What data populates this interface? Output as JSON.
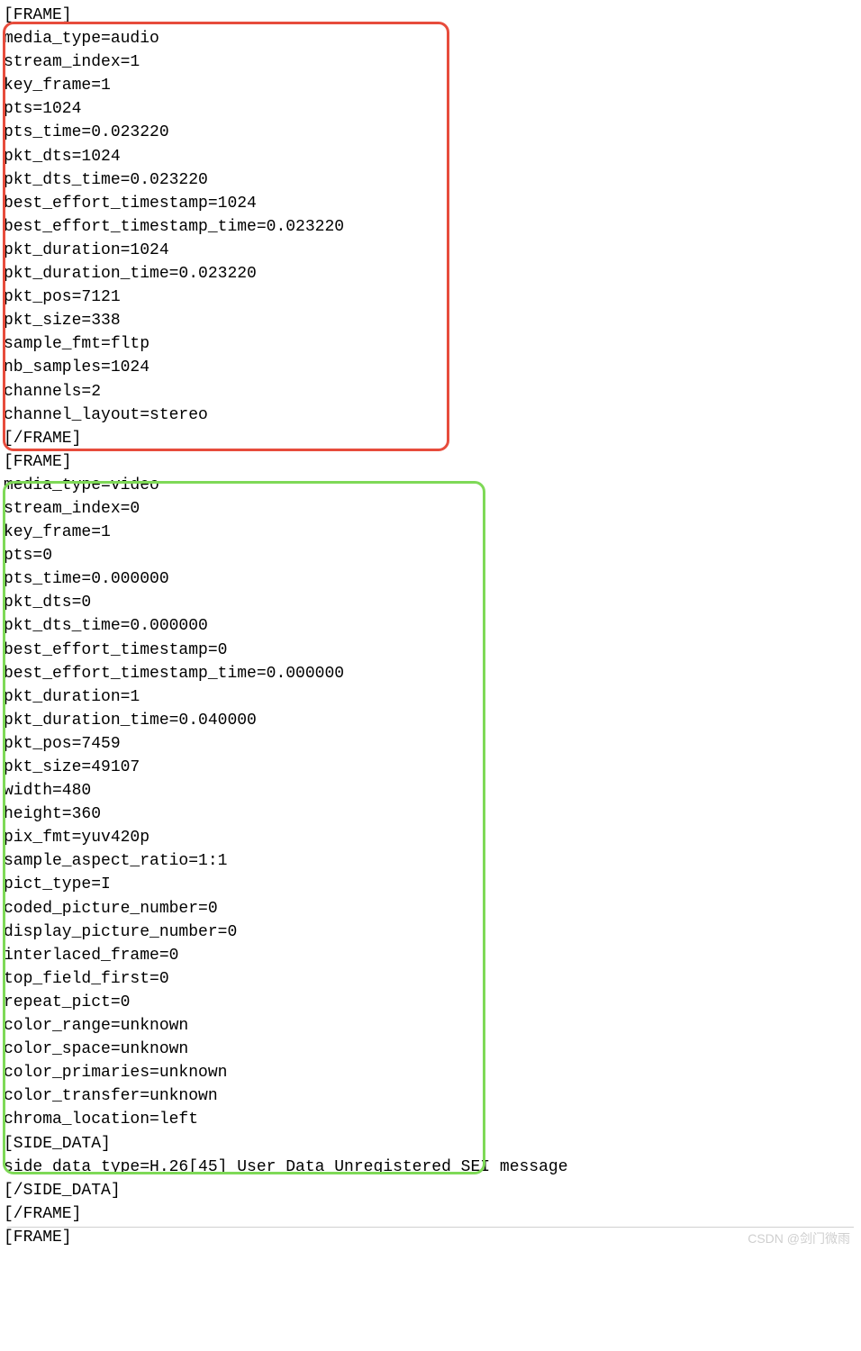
{
  "lines": {
    "l0": "[FRAME]",
    "audio": {
      "media_type": "media_type=audio",
      "stream_index": "stream_index=1",
      "key_frame": "key_frame=1",
      "pts": "pts=1024",
      "pts_time": "pts_time=0.023220",
      "pkt_dts": "pkt_dts=1024",
      "pkt_dts_time": "pkt_dts_time=0.023220",
      "best_effort_timestamp": "best_effort_timestamp=1024",
      "best_effort_timestamp_time": "best_effort_timestamp_time=0.023220",
      "pkt_duration": "pkt_duration=1024",
      "pkt_duration_time": "pkt_duration_time=0.023220",
      "pkt_pos": "pkt_pos=7121",
      "pkt_size": "pkt_size=338",
      "sample_fmt": "sample_fmt=fltp",
      "nb_samples": "nb_samples=1024",
      "channels": "channels=2",
      "channel_layout": "channel_layout=stereo"
    },
    "end_frame1": "[/FRAME]",
    "frame2": "[FRAME]",
    "video": {
      "media_type": "media_type=video",
      "stream_index": "stream_index=0",
      "key_frame": "key_frame=1",
      "pts": "pts=0",
      "pts_time": "pts_time=0.000000",
      "pkt_dts": "pkt_dts=0",
      "pkt_dts_time": "pkt_dts_time=0.000000",
      "best_effort_timestamp": "best_effort_timestamp=0",
      "best_effort_timestamp_time": "best_effort_timestamp_time=0.000000",
      "pkt_duration": "pkt_duration=1",
      "pkt_duration_time": "pkt_duration_time=0.040000",
      "pkt_pos": "pkt_pos=7459",
      "pkt_size": "pkt_size=49107",
      "width": "width=480",
      "height": "height=360",
      "pix_fmt": "pix_fmt=yuv420p",
      "sample_aspect_ratio": "sample_aspect_ratio=1:1",
      "pict_type": "pict_type=I",
      "coded_picture_number": "coded_picture_number=0",
      "display_picture_number": "display_picture_number=0",
      "interlaced_frame": "interlaced_frame=0",
      "top_field_first": "top_field_first=0",
      "repeat_pict": "repeat_pict=0",
      "color_range": "color_range=unknown",
      "color_space": "color_space=unknown",
      "color_primaries": "color_primaries=unknown",
      "color_transfer": "color_transfer=unknown",
      "chroma_location": "chroma_location=left"
    },
    "side_data_open": "[SIDE_DATA]",
    "side_data_type": "side_data_type=H.26[45] User Data Unregistered SEI message",
    "side_data_close": "[/SIDE_DATA]",
    "end_frame2": "[/FRAME]",
    "frame3": "[FRAME]"
  },
  "watermark": "CSDN @剑门微雨"
}
